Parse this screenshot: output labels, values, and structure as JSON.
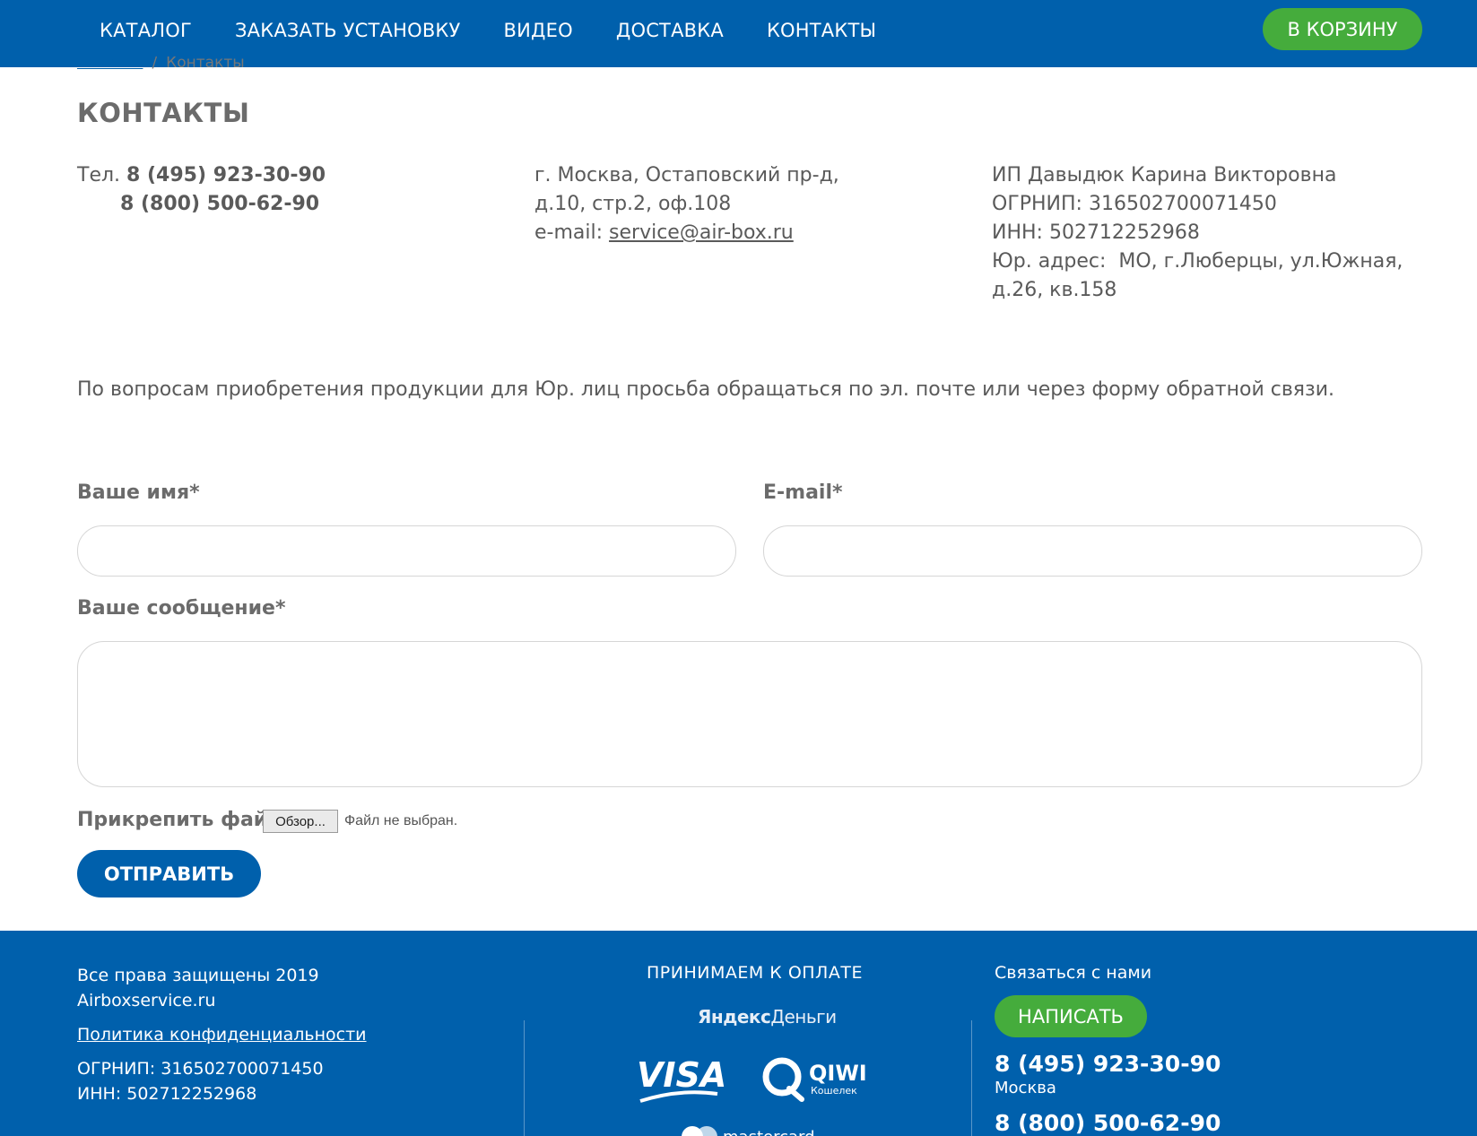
{
  "header": {
    "nav": [
      "КАТАЛОГ",
      "ЗАКАЗАТЬ УСТАНОВКУ",
      "ВИДЕО",
      "ДОСТАВКА",
      "КОНТАКТЫ"
    ],
    "cart_label": "В КОРЗИНУ"
  },
  "breadcrumb": {
    "home": "Главная",
    "separator": "/",
    "current": "Контакты"
  },
  "page_title": "КОНТАКТЫ",
  "contacts": {
    "phone_prefix": "Тел.",
    "phone1": "8 (495) 923-30-90",
    "phone2": "8 (800) 500-62-90",
    "address_line1": "г. Москва, Остаповский пр-д,",
    "address_line2": "д.10, стр.2, оф.108",
    "email_label": "e-mail:",
    "email": "service@air-box.ru",
    "company": "ИП Давыдюк Карина Викторовна",
    "ogrnip": "ОГРНИП: 316502700071450",
    "inn": "ИНН: 502712252968",
    "legal_address_line1": "Юр. адрес:  МО, г.Люберцы, ул.Южная,",
    "legal_address_line2": "д.26, кв.158"
  },
  "notice": "По вопросам приобретения продукции для Юр. лиц просьба обращаться по эл. почте или через форму обратной связи.",
  "form": {
    "name_label": "Ваше имя*",
    "name_value": "",
    "email_label": "E-mail*",
    "email_value": "",
    "message_label": "Ваше сообщение*",
    "message_value": "",
    "attach_label": "Прикрепить файл",
    "browse_label": "Обзор...",
    "file_status": "Файл не выбран.",
    "submit_label": "ОТПРАВИТЬ"
  },
  "footer": {
    "rights": "Все права защищены 2019",
    "site": "Airboxservice.ru",
    "policy": "Политика конфиденциальности",
    "ogrnip": "ОГРНИП: 316502700071450",
    "inn": "ИНН: 502712252968",
    "payment_title": "ПРИНИМАЕМ К ОПЛАТЕ",
    "yandex_part1": "Яндекс",
    "yandex_part2": "Деньги",
    "visa": "VISA",
    "qiwi": "QIWI",
    "qiwi_sub": "Кошелек",
    "mastercard": "mastercard",
    "contact_title": "Связаться с нами",
    "write_label": "НАПИСАТЬ",
    "phone1": "8 (495) 923-30-90",
    "city": "Москва",
    "phone2": "8 (800) 500-62-90"
  },
  "colors": {
    "brand_blue": "#0060ac",
    "accent_green": "#45ac3c"
  },
  "icons": [
    "visa-logo",
    "qiwi-logo",
    "mastercard-logo"
  ]
}
